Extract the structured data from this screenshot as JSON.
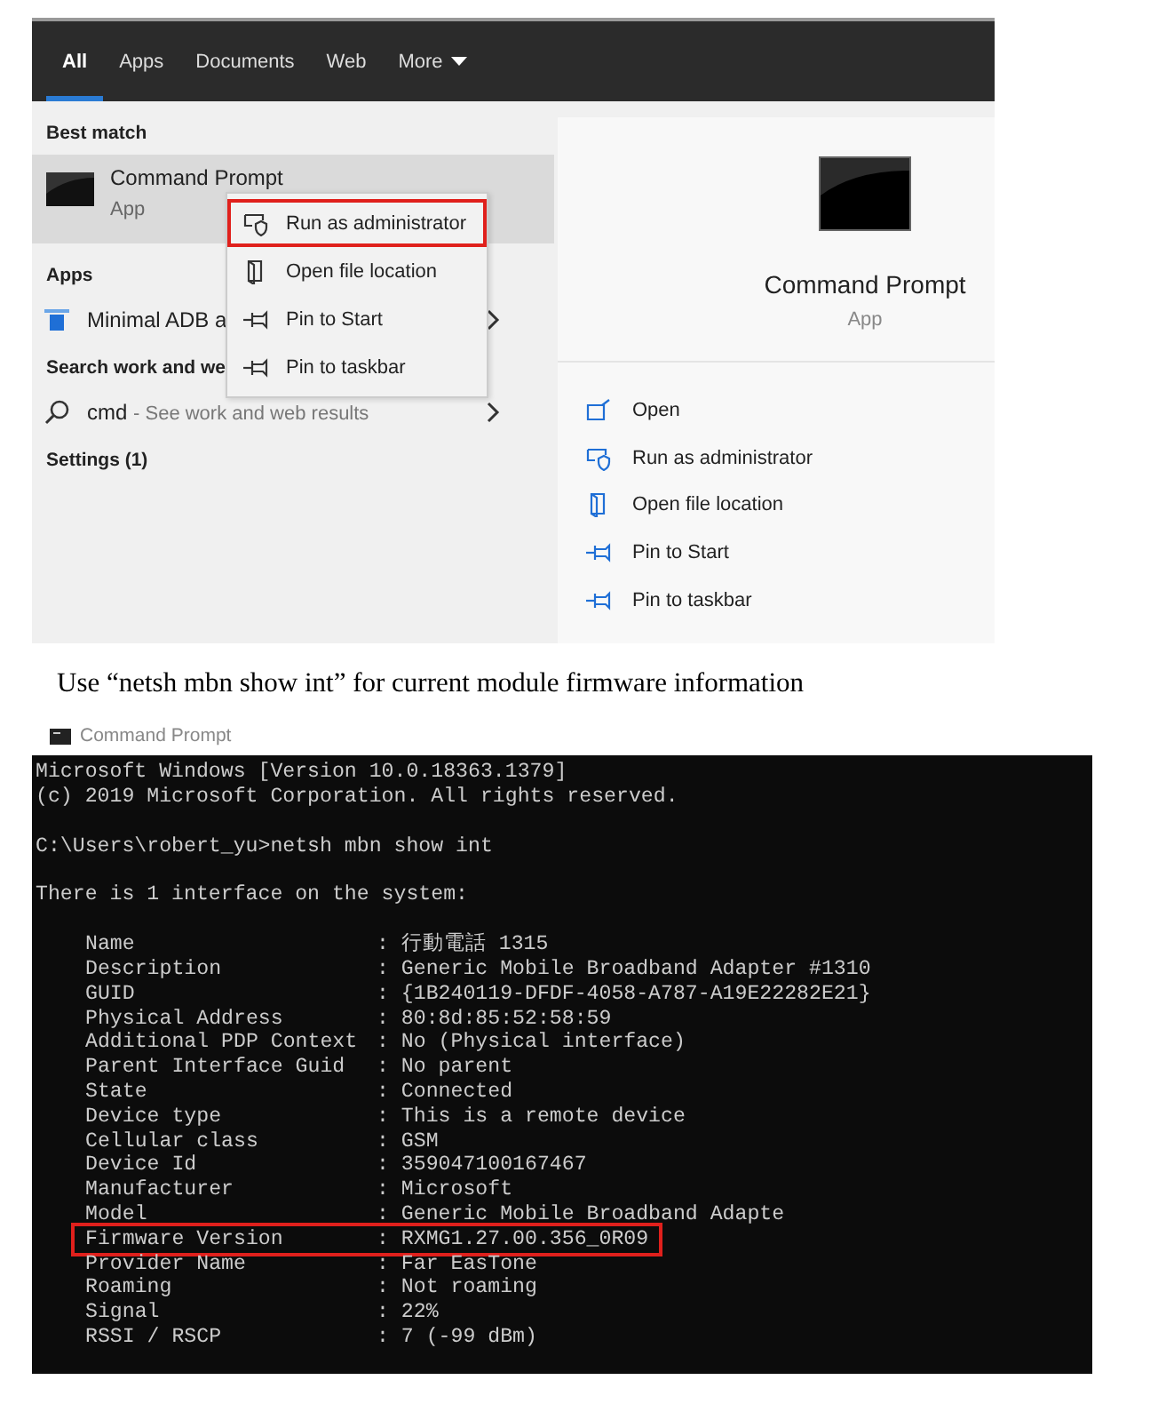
{
  "search_window": {
    "tabs": [
      {
        "label": "All",
        "selected": true
      },
      {
        "label": "Apps",
        "selected": false
      },
      {
        "label": "Documents",
        "selected": false
      },
      {
        "label": "Web",
        "selected": false
      },
      {
        "label": "More",
        "selected": false,
        "dropdown": true
      }
    ],
    "results": [
      {
        "kind": "header",
        "label": "Best match"
      },
      {
        "kind": "best",
        "title": "Command Prompt",
        "subtitle": "App",
        "selected": true
      },
      {
        "kind": "header",
        "label": "Apps"
      },
      {
        "kind": "app",
        "title": "Minimal ADB a",
        "chevron": true
      },
      {
        "kind": "header",
        "label": "Search work and we"
      },
      {
        "kind": "web",
        "title": "cmd",
        "subtitle": "- See work and web results",
        "chevron": true
      },
      {
        "kind": "header",
        "label": "Settings (1)"
      }
    ],
    "context_menu": [
      {
        "kind": "shield",
        "label": "Run as administrator",
        "highlighted": true
      },
      {
        "kind": "folder",
        "label": "Open file location",
        "highlighted": false
      },
      {
        "kind": "pin",
        "label": "Pin to Start",
        "highlighted": false
      },
      {
        "kind": "pin",
        "label": "Pin to taskbar",
        "highlighted": false
      }
    ],
    "preview": {
      "title": "Command Prompt",
      "subtitle": "App",
      "actions": [
        {
          "kind": "open",
          "label": "Open"
        },
        {
          "kind": "shield",
          "label": "Run as administrator"
        },
        {
          "kind": "folder",
          "label": "Open file location"
        },
        {
          "kind": "pin",
          "label": "Pin to Start"
        },
        {
          "kind": "pin",
          "label": "Pin to taskbar"
        }
      ]
    }
  },
  "caption": "Use “netsh mbn show int” for current module firmware information",
  "console": {
    "title": "Command Prompt",
    "header_lines": [
      "Microsoft Windows [Version 10.0.18363.1379]",
      "(c) 2019 Microsoft Corporation. All rights reserved."
    ],
    "command": "C:\\Users\\robert_yu>netsh mbn show int",
    "message": "There is 1 interface on the system:",
    "fields": [
      {
        "label": "Name",
        "value": ": 行動電話 1315",
        "highlighted": false
      },
      {
        "label": "Description",
        "value": ": Generic Mobile Broadband Adapter #1310",
        "highlighted": false
      },
      {
        "label": "GUID",
        "value": ": {1B240119-DFDF-4058-A787-A19E22282E21}",
        "highlighted": false
      },
      {
        "label": "Physical Address",
        "value": ": 80:8d:85:52:58:59",
        "highlighted": false
      },
      {
        "label": "Additional PDP Context",
        "value": ": No (Physical interface)",
        "highlighted": false
      },
      {
        "label": "Parent Interface Guid",
        "value": ": No parent",
        "highlighted": false
      },
      {
        "label": "State",
        "value": ": Connected",
        "highlighted": false
      },
      {
        "label": "Device type",
        "value": ": This is a remote device",
        "highlighted": false
      },
      {
        "label": "Cellular class",
        "value": ": GSM",
        "highlighted": false
      },
      {
        "label": "Device Id",
        "value": ": 359047100167467",
        "highlighted": false
      },
      {
        "label": "Manufacturer",
        "value": ": Microsoft",
        "highlighted": false
      },
      {
        "label": "Model",
        "value": ": Generic Mobile Broadband Adapte",
        "highlighted": false
      },
      {
        "label": "Firmware Version",
        "value": ": RXMG1.27.00.356_0R09",
        "highlighted": true
      },
      {
        "label": "Provider Name",
        "value": ": Far EasTone",
        "highlighted": false
      },
      {
        "label": "Roaming",
        "value": ": Not roaming",
        "highlighted": false
      },
      {
        "label": "Signal",
        "value": ": 22%",
        "highlighted": false
      },
      {
        "label": "RSSI / RSCP",
        "value": ": 7 (-99 dBm)",
        "highlighted": false
      }
    ]
  }
}
